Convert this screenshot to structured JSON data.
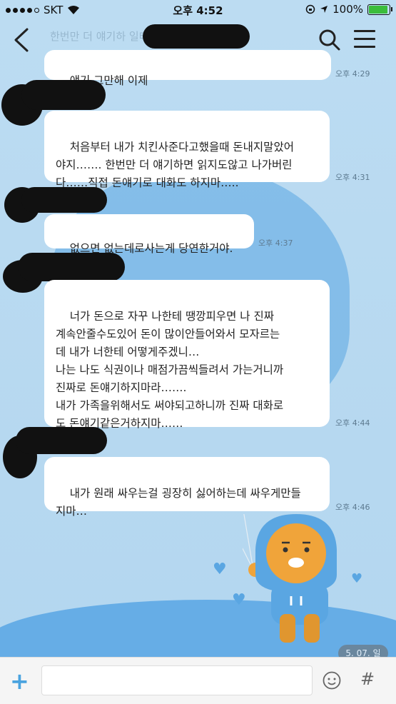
{
  "status_bar": {
    "carrier": "SKT",
    "time": "오후 4:52",
    "battery": "100%"
  },
  "header": {
    "bg_text": "한번만 더 얘기하            일테니까 돈"
  },
  "messages": [
    {
      "text": "얘기 그만해 이제",
      "time": "오후 4:29"
    },
    {
      "text": "처음부터 내가 치킨사준다고했을때 돈내지말았어\n야지……. 한번만 더 얘기하면 읽지도않고 나가버린\n다……직접 돈얘기로 대화도 하지마…..",
      "time": "오후 4:31"
    },
    {
      "text": "없으면 없는데로사는게 당연한거야.",
      "time": "오후 4:37"
    },
    {
      "text": "너가 돈으로 자꾸 나한테 땡깡피우면 나 진짜\n계속안줄수도있어 돈이 많이안들어와서 모자르는\n데 내가 너한테 어떻게주겠니…\n나는 나도 식권이나 매점가끔씩들려서 가는거니까\n진짜로 돈얘기하지마라…….\n내가 가족을위해서도 써야되고하니까 진짜 대화로\n도 돈얘기같은거하지마……",
      "time": "오후 4:44"
    },
    {
      "text": "내가 원래 싸우는걸 굉장히 싫어하는데 싸우게만들\n지마…",
      "time": "오후 4:46"
    }
  ],
  "date_badge": "5. 07. 일",
  "input": {
    "value": ""
  },
  "colors": {
    "background": "#b7d9f0",
    "accent": "#4aa3df",
    "bubble": "#ffffff"
  }
}
